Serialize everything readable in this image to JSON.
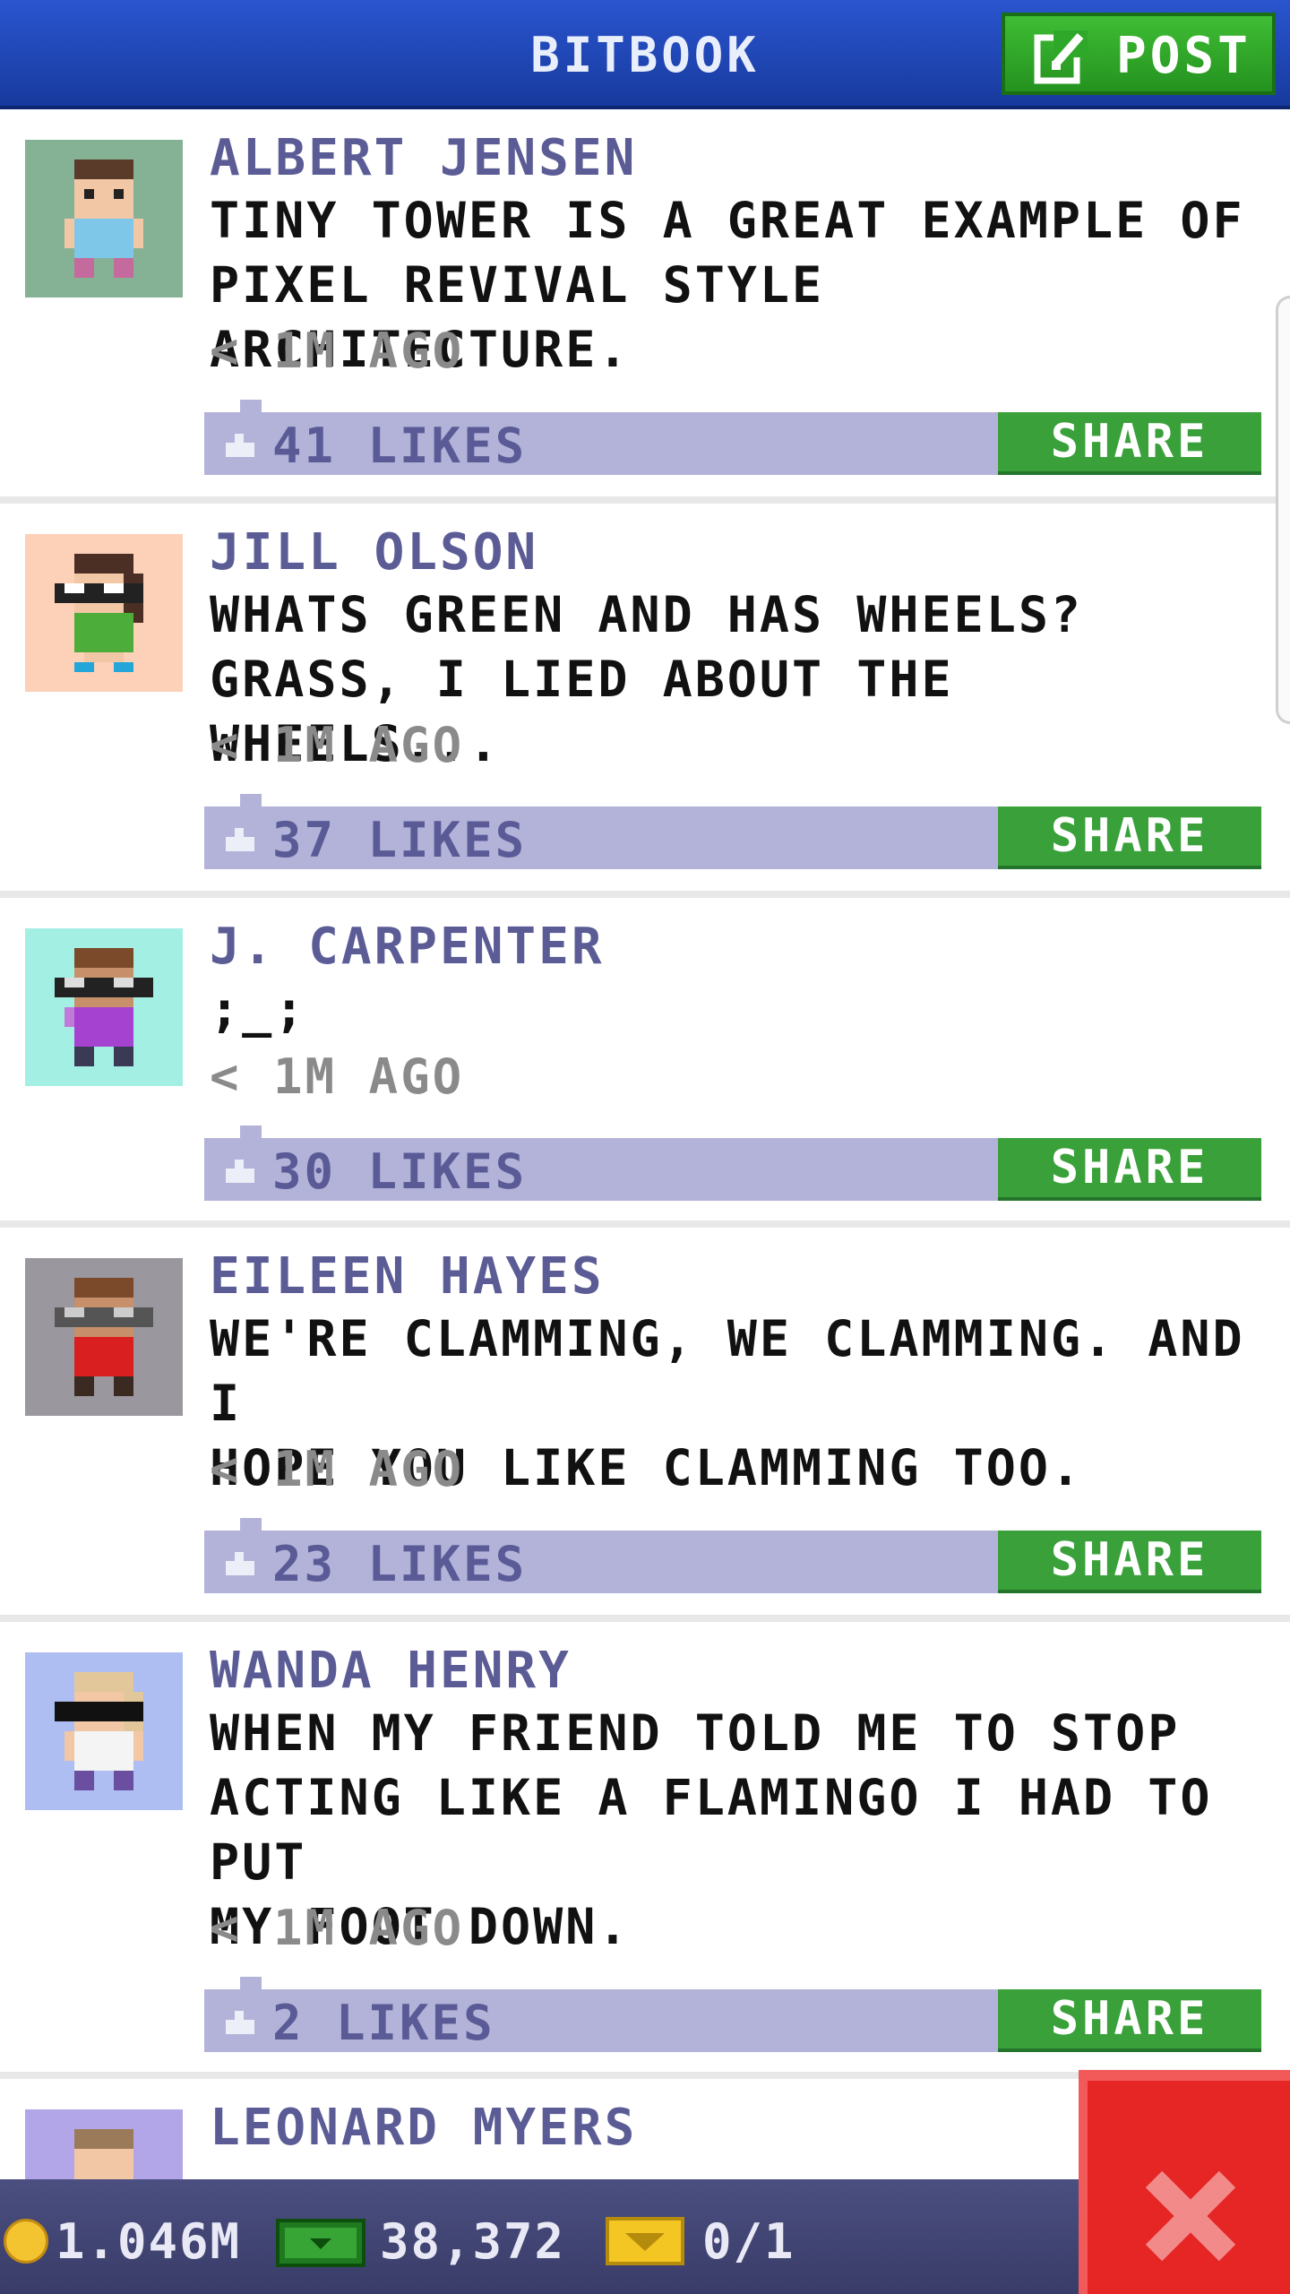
{
  "header": {
    "title": "BITBOOK",
    "post_label": "POST"
  },
  "posts": [
    {
      "author": "ALBERT JENSEN",
      "lines": [
        "TINY TOWER IS A GREAT EXAMPLE OF",
        "PIXEL REVIVAL STYLE ARCHITECTURE."
      ],
      "time": "< 1M AGO",
      "likes": "41 LIKES",
      "share": "SHARE"
    },
    {
      "author": "JILL OLSON",
      "lines": [
        "WHATS GREEN AND HAS WHEELS?",
        "GRASS, I LIED ABOUT THE WHEELS..."
      ],
      "time": "< 1M AGO",
      "likes": "37 LIKES",
      "share": "SHARE"
    },
    {
      "author": "J. CARPENTER",
      "lines": [
        ";_;"
      ],
      "time": "< 1M AGO",
      "likes": "30 LIKES",
      "share": "SHARE"
    },
    {
      "author": "EILEEN HAYES",
      "lines": [
        "WE'RE CLAMMING, WE CLAMMING. AND I",
        "HOPE YOU LIKE CLAMMING TOO."
      ],
      "time": "< 1M AGO",
      "likes": "23 LIKES",
      "share": "SHARE"
    },
    {
      "author": "WANDA HENRY",
      "lines": [
        "WHEN MY FRIEND TOLD ME TO STOP",
        "ACTING LIKE A FLAMINGO I HAD TO PUT",
        "MY FOOT DOWN."
      ],
      "time": "< 1M AGO",
      "likes": "2 LIKES",
      "share": "SHARE"
    },
    {
      "author": "LEONARD MYERS"
    }
  ],
  "footer": {
    "coins": "1.046M",
    "bux": "38,372",
    "tickets": "0/1"
  },
  "colors": {
    "header": "#1f46b8",
    "share": "#3aa13a",
    "like_bar": "#b3b3d9",
    "close": "#e62525"
  },
  "icons": {
    "post": "edit-icon",
    "like": "thumbs-up-icon",
    "coin": "coin-icon",
    "bux": "bux-icon",
    "ticket": "ticket-icon",
    "close": "close-icon"
  }
}
